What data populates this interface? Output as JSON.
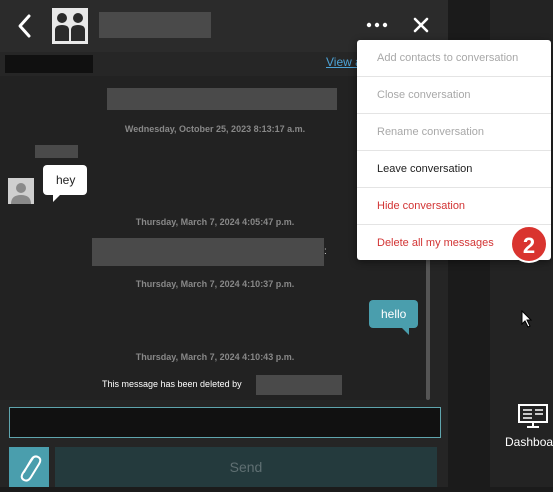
{
  "header": {
    "back_icon": "chevron-left-icon",
    "avatar_icon": "group-avatar-icon",
    "more_icon": "more-horizontal-icon",
    "close_icon": "close-icon"
  },
  "subbar": {
    "view_link": "View a"
  },
  "messages": {
    "timestamps": [
      "Wednesday, October 25, 2023 8:13:17 a.m.",
      "Thursday, March 7, 2024 4:05:47 p.m.",
      "Thursday, March 7, 2024 4:10:37 p.m.",
      "Thursday, March 7, 2024 4:10:43 p.m."
    ],
    "incoming_text": "hey",
    "outgoing_text": "hello",
    "deleted_note": "This message has been deleted by",
    "redacted_colon": ":"
  },
  "composer": {
    "input_value": "",
    "send_label": "Send",
    "attach_icon": "paperclip-icon"
  },
  "right_panel": {
    "dashboard_label": "Dashboa",
    "dashboard_icon": "dashboard-monitor-icon"
  },
  "menu": {
    "items": [
      {
        "label": "Add contacts to conversation",
        "state": "disabled"
      },
      {
        "label": "Close conversation",
        "state": "disabled"
      },
      {
        "label": "Rename conversation",
        "state": "disabled"
      },
      {
        "label": "Leave conversation",
        "state": "normal"
      },
      {
        "label": "Hide conversation",
        "state": "danger"
      },
      {
        "label": "Delete all my messages",
        "state": "danger"
      }
    ]
  },
  "annotation": {
    "step_badge": "2"
  },
  "colors": {
    "accent": "#4a9ead",
    "danger": "#d23434",
    "badge": "#d9342f",
    "link": "#4da3d6"
  }
}
